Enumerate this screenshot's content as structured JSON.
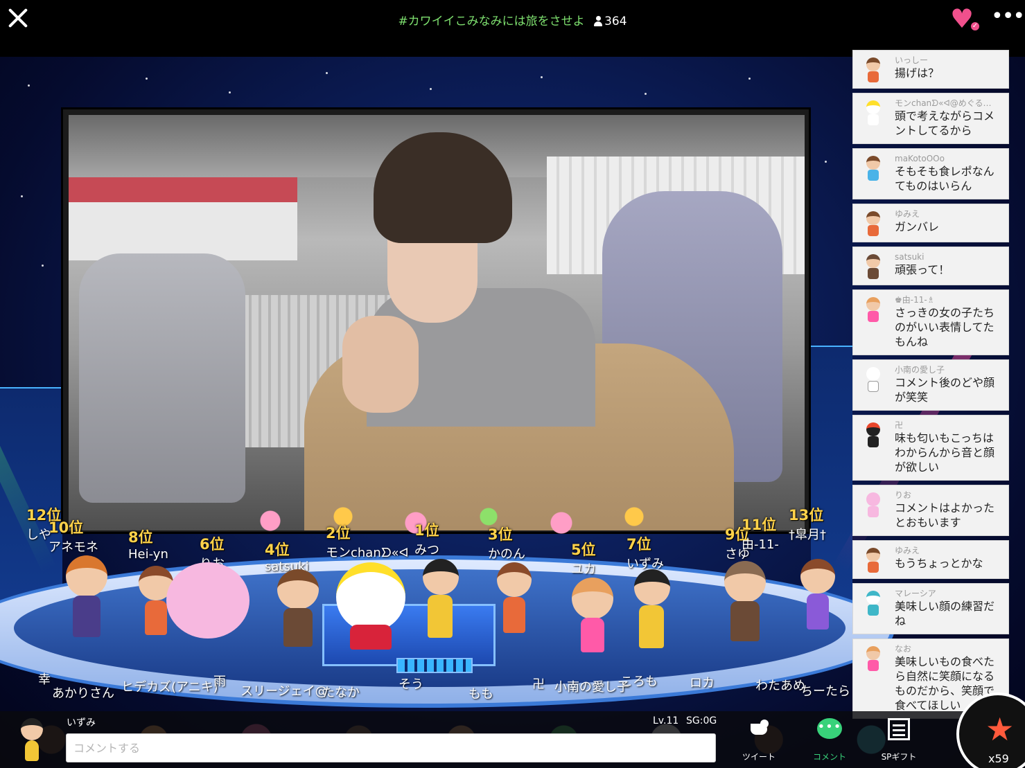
{
  "header": {
    "title": "#カワイイこみなみには旅をさせよ",
    "viewer_count": "364"
  },
  "ranking": [
    {
      "position": "12位",
      "name": "しや"
    },
    {
      "position": "10位",
      "name": "アネモネ"
    },
    {
      "position": "8位",
      "name": "Hei-yn"
    },
    {
      "position": "6位",
      "name": "りお"
    },
    {
      "position": "4位",
      "name": "satsuki"
    },
    {
      "position": "2位",
      "name": "モンchanᗤ«ᐊ"
    },
    {
      "position": "1位",
      "name": "みつ"
    },
    {
      "position": "3位",
      "name": "かのん"
    },
    {
      "position": "5位",
      "name": "ユカ"
    },
    {
      "position": "7位",
      "name": "いずみ"
    },
    {
      "position": "9位",
      "name": "さゆ"
    },
    {
      "position": "11位",
      "name": "由-11-"
    },
    {
      "position": "13位",
      "name": "†皐月†"
    }
  ],
  "crowd_names": [
    "幸",
    "あかりさん",
    "ヒデカズ(アニキ)",
    "雨",
    "スリージェイ@",
    "たなか",
    "そう",
    "もも",
    "卍",
    "小南の愛し子",
    "ころも",
    "ロカ",
    "わたあめ",
    "ちーたら"
  ],
  "comments": [
    {
      "user": "いっしー",
      "text": "揚げは？"
    },
    {
      "user": "モンchanᗤ«ᐊ@めぐる…",
      "text": "頭で考えながらコメントしてるから"
    },
    {
      "user": "maKotoOOo",
      "text": "そもそも食レポなんてものはいらん"
    },
    {
      "user": "ゆみえ",
      "text": "ガンバレ"
    },
    {
      "user": "satsuki",
      "text": "頑張って！"
    },
    {
      "user": "♚由-11-♗",
      "text": "さっきの女の子たちのがいい表情してたもんね"
    },
    {
      "user": "小南の愛し子",
      "text": "コメント後のどや顔が笑笑"
    },
    {
      "user": "卍",
      "text": "味も匂いもこっちはわからんから音と顔が欲しい"
    },
    {
      "user": "りお",
      "text": "コメントはよかったとおもいます"
    },
    {
      "user": "ゆみえ",
      "text": "もうちょっとかな"
    },
    {
      "user": "マレーシア",
      "text": "美味しい顔の練習だね"
    },
    {
      "user": "なお",
      "text": "美味しいもの食べたら自然に笑顔になるものだから、笑顔で食べてほしい"
    }
  ],
  "bottom": {
    "user_name": "いずみ",
    "level": "Lv.11",
    "sg": "SG:0G",
    "input_placeholder": "コメントする",
    "tweet_label": "ツイート",
    "comment_label": "コメント",
    "sp_gift_label": "SPギフト",
    "star_count": "x59"
  },
  "colors": {
    "title_green": "#7ee06f",
    "heart_pink": "#f0508c",
    "rank_gold": "#ffd24a",
    "comment_green": "#38d27a",
    "star_orange": "#ff5a3c"
  }
}
